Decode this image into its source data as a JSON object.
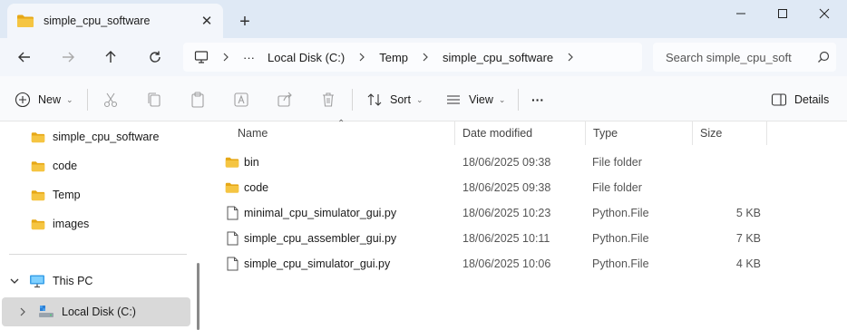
{
  "window": {
    "tab_title": "simple_cpu_software",
    "tab_close_glyph": "✕",
    "new_tab_glyph": "+",
    "controls": {
      "minimize": "minimize-icon",
      "maximize": "maximize-icon",
      "close": "close-icon"
    }
  },
  "nav": {
    "breadcrumb": [
      "Local Disk (C:)",
      "Temp",
      "simple_cpu_software"
    ],
    "overflow": "···",
    "search_placeholder": "Search simple_cpu_soft"
  },
  "toolbar": {
    "new_label": "New",
    "sort_label": "Sort",
    "view_label": "View",
    "more_label": "···",
    "details_label": "Details"
  },
  "sidebar": {
    "folders": [
      "simple_cpu_software",
      "code",
      "Temp",
      "images"
    ],
    "this_pc": "This PC",
    "local_disk": "Local Disk (C:)"
  },
  "columns": {
    "name": "Name",
    "date": "Date modified",
    "type": "Type",
    "size": "Size"
  },
  "files": [
    {
      "kind": "folder",
      "name": "bin",
      "date": "18/06/2025 09:38",
      "type": "File folder",
      "size": ""
    },
    {
      "kind": "folder",
      "name": "code",
      "date": "18/06/2025 09:38",
      "type": "File folder",
      "size": ""
    },
    {
      "kind": "file",
      "name": "minimal_cpu_simulator_gui.py",
      "date": "18/06/2025 10:23",
      "type": "Python.File",
      "size": "5 KB"
    },
    {
      "kind": "file",
      "name": "simple_cpu_assembler_gui.py",
      "date": "18/06/2025 10:11",
      "type": "Python.File",
      "size": "7 KB"
    },
    {
      "kind": "file",
      "name": "simple_cpu_simulator_gui.py",
      "date": "18/06/2025 10:06",
      "type": "Python.File",
      "size": "4 KB"
    }
  ],
  "colors": {
    "folder": "#f5c542",
    "folder_dark": "#e6a817",
    "titlebar": "#dfe9f5",
    "selected": "#d9d9d9"
  }
}
